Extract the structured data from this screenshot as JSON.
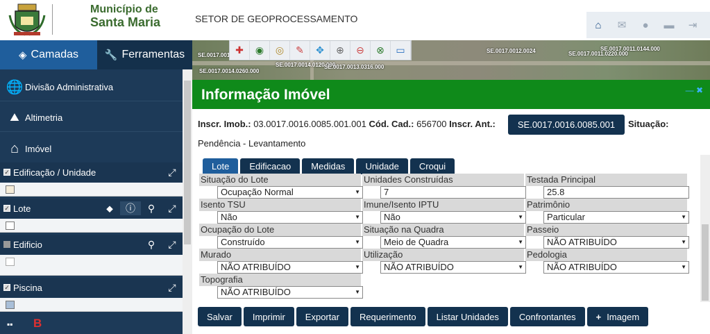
{
  "header": {
    "municipio_line1": "Município de",
    "municipio_line2": "Santa Maria",
    "setor": "SETOR DE GEOPROCESSAMENTO"
  },
  "sidebar": {
    "tabs": [
      {
        "label": "Camadas"
      },
      {
        "label": "Ferramentas"
      }
    ],
    "items": [
      {
        "label": "Divisão Administrativa"
      },
      {
        "label": "Altimetria"
      },
      {
        "label": "Imóvel"
      }
    ],
    "layers": [
      {
        "label": "Edificação / Unidade",
        "checked": true
      },
      {
        "label": "Lote",
        "checked": true
      },
      {
        "label": "Edificio",
        "checked": false
      },
      {
        "label": "Piscina",
        "checked": true
      }
    ]
  },
  "map": {
    "labels": [
      "SE.0017.001",
      "SE.0017.0014.0120.000",
      "SE.0017.0014.0260.000",
      "SE.0017.0013.0316.000",
      "SE.0017.0012.0024",
      "SE.0017.0011.0144.000",
      "SE.0017.0011.0220.000"
    ]
  },
  "modal": {
    "title": "Informação Imóvel",
    "inscr_imob_label": "Inscr. Imob.:",
    "inscr_imob": "03.0017.0016.0085.001.001",
    "cod_cad_label": "Cód. Cad.:",
    "cod_cad": "656700",
    "inscr_ant_label": "Inscr. Ant.:",
    "inscr_ant": "SE.0017.0016.0085.001",
    "situacao_label": "Situação:",
    "pendencia": "Pendência - Levantamento",
    "tabs": [
      "Lote",
      "Edificacao",
      "Medidas",
      "Unidade",
      "Croqui"
    ],
    "fields": [
      {
        "label": "Situação do Lote",
        "value": "Ocupação Normal",
        "select": true
      },
      {
        "label": "Unidades Construídas",
        "value": "7",
        "select": false
      },
      {
        "label": "Testada Principal",
        "value": "25.8",
        "select": false
      },
      {
        "label": "Isento TSU",
        "value": "Não",
        "select": true
      },
      {
        "label": "Imune/Isento IPTU",
        "value": "Não",
        "select": true
      },
      {
        "label": "Patrimônio",
        "value": "Particular",
        "select": true
      },
      {
        "label": "Ocupação do Lote",
        "value": "Construído",
        "select": true
      },
      {
        "label": "Situação na Quadra",
        "value": "Meio de Quadra",
        "select": true
      },
      {
        "label": "Passeio",
        "value": "NÃO ATRIBUÍDO",
        "select": true
      },
      {
        "label": "Murado",
        "value": "NÃO ATRIBUÍDO",
        "select": true
      },
      {
        "label": "Utilização",
        "value": "NÃO ATRIBUÍDO",
        "select": true
      },
      {
        "label": "Pedologia",
        "value": "NÃO ATRIBUÍDO",
        "select": true
      },
      {
        "label": "Topografia",
        "value": "NÃO ATRIBUÍDO",
        "select": true
      }
    ],
    "buttons": [
      "Salvar",
      "Imprimir",
      "Exportar",
      "Requerimento",
      "Listar Unidades",
      "Confrontantes",
      "Imagem"
    ]
  },
  "colors": {
    "modal_header": "#0f8a1a",
    "sidebar_bg": "#1d3a58",
    "button_bg": "#13324f"
  },
  "icons": [
    "home-icon",
    "email-icon",
    "user-icon",
    "video-icon",
    "logout-icon"
  ]
}
